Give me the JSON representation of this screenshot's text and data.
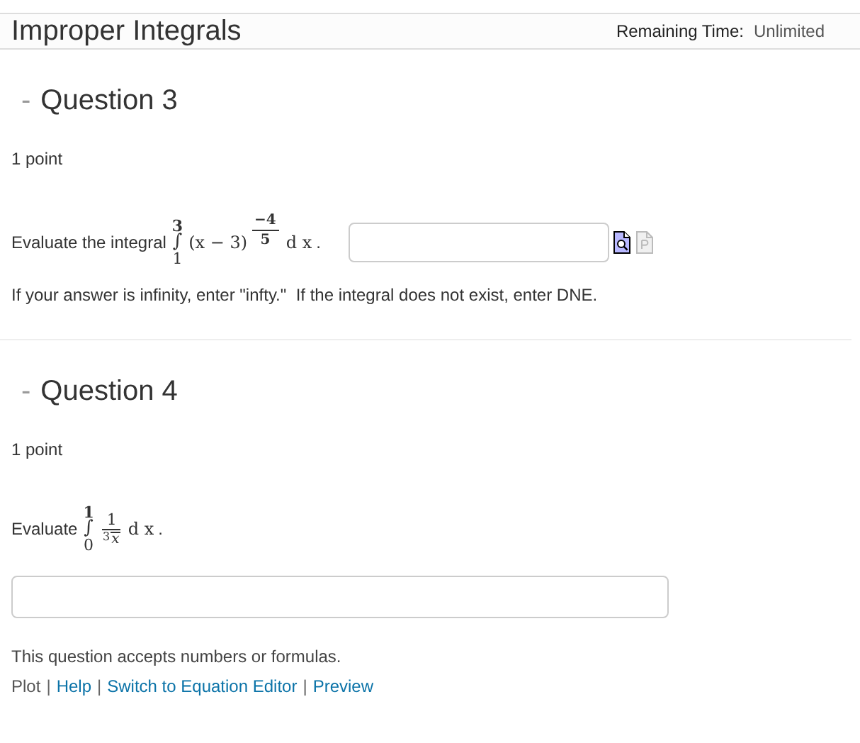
{
  "header": {
    "title": "Improper Integrals",
    "remaining_label": "Remaining Time:",
    "remaining_value": "Unlimited"
  },
  "questions": [
    {
      "toggle": "-",
      "title": "Question 3",
      "points": "1 point",
      "kind": "inline",
      "prompt": "Evaluate the integral",
      "math": {
        "kind": "power",
        "integral": "∫",
        "upper": "3",
        "lower": "1",
        "base": "(x − 3)",
        "exp_num": "−4",
        "exp_den": "5",
        "differential": "d x",
        "end": "."
      },
      "hint": "If your answer is infinity, enter \"infty.\"  If the integral does not exist, enter DNE."
    },
    {
      "toggle": "-",
      "title": "Question 4",
      "points": "1 point",
      "kind": "block",
      "prompt": "Evaluate",
      "math": {
        "kind": "fraction",
        "integral": "∫",
        "upper": "1",
        "lower": "0",
        "num": "1",
        "root_index": "3",
        "radicand": "x",
        "differential": "d x",
        "end": "."
      },
      "note": "This question accepts numbers or formulas.",
      "links": [
        {
          "label": "Plot",
          "disabled": true
        },
        {
          "label": "Help",
          "disabled": false
        },
        {
          "label": "Switch to Equation Editor",
          "disabled": false
        },
        {
          "label": "Preview",
          "disabled": false
        }
      ],
      "separator": "|"
    }
  ]
}
